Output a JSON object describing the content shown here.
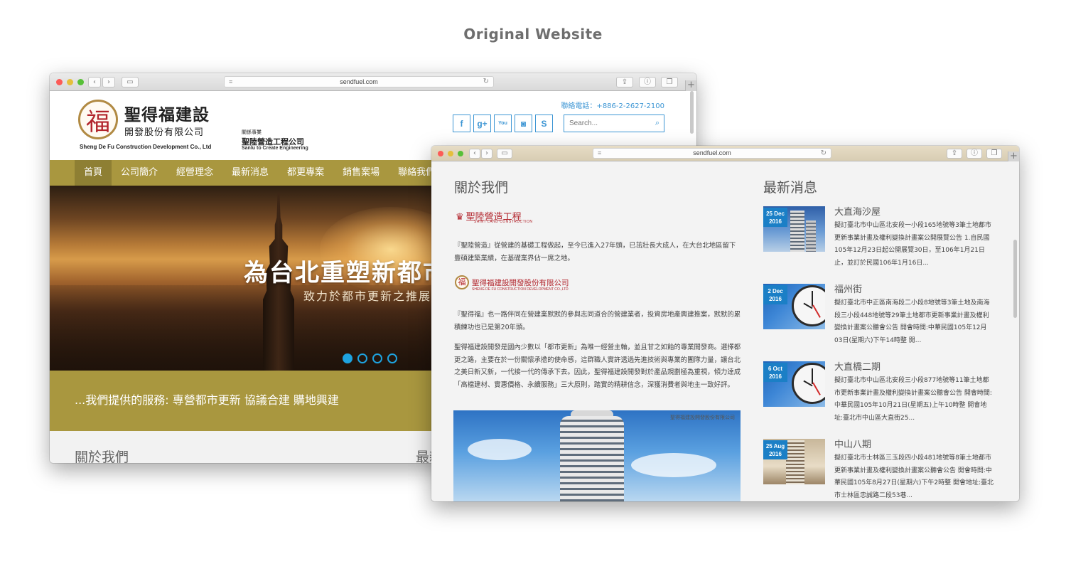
{
  "page_heading": "Original Website",
  "window1": {
    "url": "sendfuel.com",
    "header": {
      "logo_char": "福",
      "company_name": "聖得福建設",
      "company_sub": "開發股份有限公司",
      "company_en": "Sheng De Fu Construction Development Co., Ltd",
      "affiliate_label": "關係事業",
      "affiliate_name": "聖陸營造工程公司",
      "affiliate_en": "Sanlu to Create Engineering",
      "phone": "聯絡電話：+886-2-2627-2100",
      "search_placeholder": "Search...",
      "social": [
        {
          "icon": "facebook-icon",
          "glyph": "f"
        },
        {
          "icon": "google-plus-icon",
          "glyph": "g+"
        },
        {
          "icon": "youtube-icon",
          "glyph": "You"
        },
        {
          "icon": "instagram-icon",
          "glyph": "◙"
        },
        {
          "icon": "skype-icon",
          "glyph": "S"
        }
      ]
    },
    "nav": [
      "首頁",
      "公司簡介",
      "經營理念",
      "最新消息",
      "都更專案",
      "銷售案場",
      "聯絡我們"
    ],
    "hero": {
      "title": "為台北重塑新都市",
      "subtitle": "致力於都市更新之推展"
    },
    "band_text": "...我們提供的服務: 專營都市更新 協議合建 購地興建",
    "section_left": "關於我們",
    "section_right": "最新消息"
  },
  "window2": {
    "url": "sendfuel.com",
    "about": {
      "title": "關於我們",
      "logo_a_name": "聖陸營造工程",
      "logo_a_en": "SAINT LAND CONSTRUCTION",
      "para1": "『聖陸營造』從營建的基礎工程做起，至今已進入27年頭，已茁壯長大成人，在大台北地區留下豐碩建築業績，在基礎業界佔一席之地。",
      "logo_b_char": "福",
      "logo_b_name": "聖得福建設開發股份有限公司",
      "logo_b_en": "SHENG DE FU CONSTRUCTION DEVELOPMENT CO.,LTD",
      "para2": "『聖得福』也一路伴同在營建業默默的參與志同道合的營建業者，投資房地產興建推案，默默的累積練功也已是第20年頭。",
      "para3": "聖得福建設開發是國內少數以「都市更新」為唯一經營主軸，並且甘之如飴的專業開發商。選擇都更之路，主要在於一份關懷承擔的使命感，這群職人實許透過先進技術與專業的團隊力量，讓台北之美日新又新，一代接一代的傳承下去。因此，聖得福建設開發對於產品規劃極為重視，傾力達成「高檔建材、實惠價格、永續服務」三大原則，踏實的精耕信念，深獲消費者與地主一致好評。",
      "photo_caption": "聖得福建設開發股份有限公司"
    },
    "news": {
      "title": "最新消息",
      "items": [
        {
          "day": "25 Dec",
          "year": "2016",
          "title": "大直海沙屋",
          "body": "擬訂臺北市中山區北安段一小段165地號等3筆土地都市更新事業計畫及權利變換計畫案公開展覽公告 1.自民國105年12月23日起公開展覽30日，至106年1月21日止，並訂於民國106年1月16日..."
        },
        {
          "day": "2 Dec",
          "year": "2016",
          "title": "福州街",
          "body": "擬訂臺北市中正區南海段二小段8地號等3筆土地及南海段三小段448地號等29筆土地都市更新事業計畫及權利變換計畫案公聽會公告 開會時間:中華民國105年12月03日(星期六)下午14時整 開..."
        },
        {
          "day": "6 Oct",
          "year": "2016",
          "title": "大直橋二期",
          "body": "擬訂臺北市中山區北安段三小段877地號等11筆土地都市更新事業計畫及權利變換計畫案公聽會公告 開會時間:中華民國105年10月21日(星期五)上午10時整 開會地址:臺北市中山區大直街25..."
        },
        {
          "day": "25 Aug",
          "year": "2016",
          "title": "中山八期",
          "body": "擬訂臺北市士林區三玉段四小段481地號等8筆土地都市更新事業計畫及權利變換計畫案公聽會公告 開會時間:中華民國105年8月27日(星期六)下午2時整 開會地址:臺北市士林區忠誠路二段53巷..."
        }
      ]
    }
  }
}
